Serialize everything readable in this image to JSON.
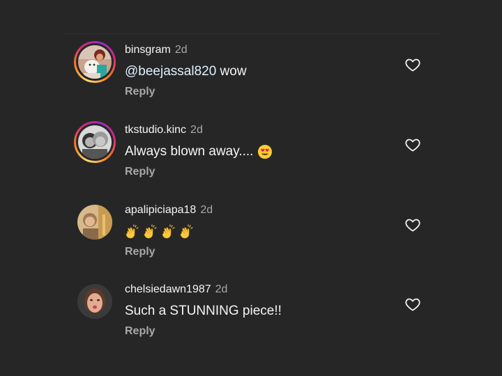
{
  "comments": [
    {
      "username": "binsgram",
      "time": "2d",
      "mention": "@beejassal820",
      "text": " wow",
      "reply": "Reply",
      "avatar_ring": true
    },
    {
      "username": "tkstudio.kinc",
      "time": "2d",
      "text": "Always blown away....",
      "emoji": "heart-eyes-emoji",
      "reply": "Reply",
      "avatar_ring": true
    },
    {
      "username": "apalipiciapa18",
      "time": "2d",
      "emoji": "clapping-hands-emoji",
      "emoji_count": 4,
      "reply": "Reply",
      "avatar_ring": false
    },
    {
      "username": "chelsiedawn1987",
      "time": "2d",
      "text": "Such a STUNNING piece!!",
      "reply": "Reply",
      "avatar_ring": false
    }
  ],
  "icons": {
    "like": "heart-outline-icon"
  },
  "colors": {
    "background": "#262626",
    "secondary_text": "#a8a8a8",
    "mention": "#e0f1ff"
  }
}
